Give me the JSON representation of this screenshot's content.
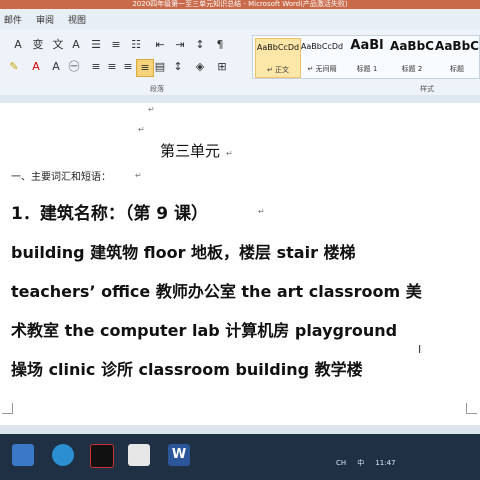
{
  "window": {
    "title": "2020四年级第一至三单元知识总结 - Microsoft Word(产品激活失败)"
  },
  "menu": {
    "items": [
      "邮件",
      "审阅",
      "视图"
    ]
  },
  "ribbon": {
    "paragraph_label": "段落",
    "styles_label": "样式",
    "styles": [
      {
        "sample": "AaBbCcDd",
        "name": "↵ 正文",
        "selected": true
      },
      {
        "sample": "AaBbCcDd",
        "name": "↵ 无间隔",
        "selected": false
      },
      {
        "sample": "AaBl",
        "name": "标题 1",
        "selected": false
      },
      {
        "sample": "AaBbC",
        "name": "标题 2",
        "selected": false
      },
      {
        "sample": "AaBbC",
        "name": "标题",
        "selected": false
      }
    ]
  },
  "document": {
    "heading": "第三单元",
    "subheading": "一、主要词汇和短语：",
    "lesson": "1．建筑名称：（第 9 课）",
    "lines": [
      "building 建筑物 floor  地板，楼层   stair  楼梯",
      "teachers’ office 教师办公室  the art classroom 美",
      "术教室  the  computer  lab  计算机房  playground",
      "操场  clinic  诊所 classroom building  教学楼"
    ]
  },
  "taskbar": {
    "tray": [
      "CH",
      "中",
      "11:47"
    ]
  }
}
